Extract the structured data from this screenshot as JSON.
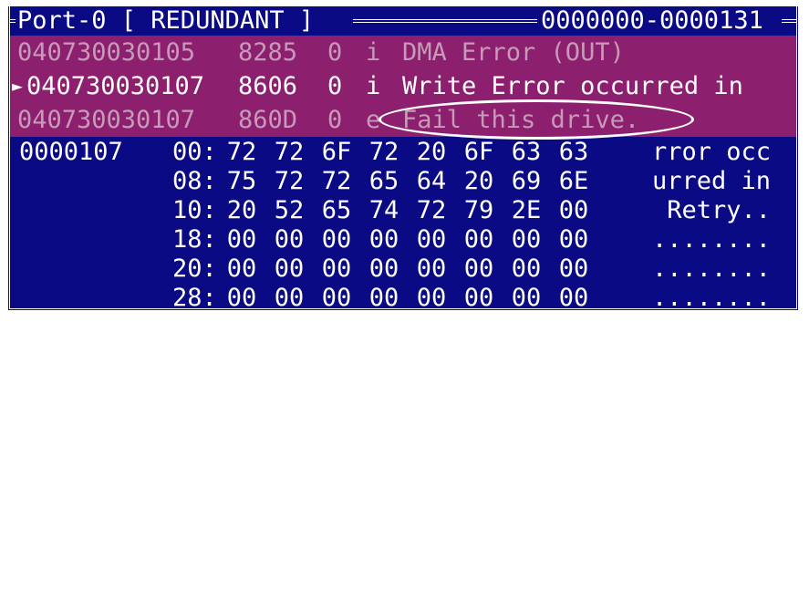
{
  "window": {
    "port_label": "Port-0 [ REDUNDANT ]",
    "range_label": "0000000-0000131"
  },
  "log": [
    {
      "timestamp": "040730030105",
      "code": "8285",
      "num": "0",
      "level": "i",
      "message": "DMA Error (OUT)",
      "selected": false
    },
    {
      "timestamp": "040730030107",
      "code": "8606",
      "num": "0",
      "level": "i",
      "message": "Write Error occurred in",
      "selected": true
    },
    {
      "timestamp": "040730030107",
      "code": "860D",
      "num": "0",
      "level": "e",
      "message": "Fail this drive.",
      "selected": false
    }
  ],
  "hexdump": {
    "address": "0000107",
    "rows": [
      {
        "offset": "00:",
        "bytes": [
          "72",
          "72",
          "6F",
          "72",
          "20",
          "6F",
          "63",
          "63"
        ],
        "ascii": "rror occ"
      },
      {
        "offset": "08:",
        "bytes": [
          "75",
          "72",
          "72",
          "65",
          "64",
          "20",
          "69",
          "6E"
        ],
        "ascii": "urred in"
      },
      {
        "offset": "10:",
        "bytes": [
          "20",
          "52",
          "65",
          "74",
          "72",
          "79",
          "2E",
          "00"
        ],
        "ascii": " Retry.."
      },
      {
        "offset": "18:",
        "bytes": [
          "00",
          "00",
          "00",
          "00",
          "00",
          "00",
          "00",
          "00"
        ],
        "ascii": "........"
      },
      {
        "offset": "20:",
        "bytes": [
          "00",
          "00",
          "00",
          "00",
          "00",
          "00",
          "00",
          "00"
        ],
        "ascii": "........"
      },
      {
        "offset": "28:",
        "bytes": [
          "00",
          "00",
          "00",
          "00",
          "00",
          "00",
          "00",
          "00"
        ],
        "ascii": "........"
      }
    ]
  },
  "colors": {
    "background": "#0a0a85",
    "log_highlight": "#8c1f6e",
    "dim_text": "#c79ab9",
    "text": "#ffffff"
  }
}
